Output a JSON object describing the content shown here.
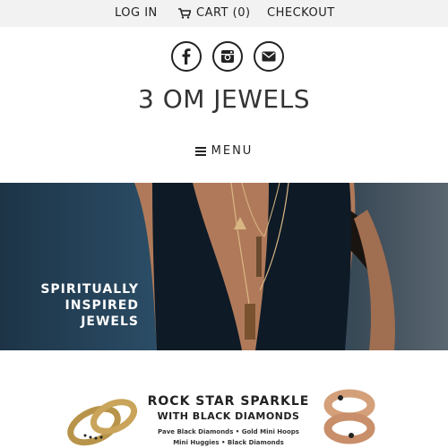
{
  "topbar": {
    "login": "LOG IN",
    "cart": "CART (0)",
    "checkout": "CHECKOUT"
  },
  "social": {
    "icons": [
      "facebook-icon",
      "instagram-icon",
      "mail-icon"
    ]
  },
  "brand": {
    "name": "3 OM JEWELS"
  },
  "nav": {
    "menu_label": "MENU"
  },
  "hero": {
    "tagline_line1": "SPIRITUALLY",
    "tagline_line2": "INSPIRED JEWELS"
  },
  "promo": {
    "title": "ROCK STAR SPARKLE",
    "subtitle": "WITH BLACK DIAMONDS",
    "line1": "Pave Black Diamonds • Gold Mini Hoops",
    "line2": "Mini Huggies • Black Diamonds"
  },
  "colors": {
    "topbar_bg": "#f2f2f2",
    "text": "#333333",
    "hero_bg": "#2b4d66"
  }
}
